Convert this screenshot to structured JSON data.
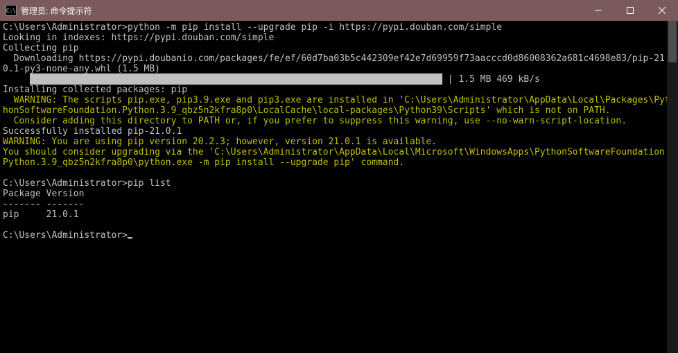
{
  "window": {
    "icon_text": "C:\\",
    "title": "管理员: 命令提示符"
  },
  "lines": [
    {
      "cls": "l-normal",
      "text": "C:\\Users\\Administrator>python -m pip install --upgrade pip -i https://pypi.douban.com/simple"
    },
    {
      "cls": "l-normal",
      "text": "Looking in indexes: https://pypi.douban.com/simple"
    },
    {
      "cls": "l-normal",
      "text": "Collecting pip"
    },
    {
      "cls": "l-normal",
      "text": "  Downloading https://pypi.doubanio.com/packages/fe/ef/60d7ba03b5c442309ef42e7d69959f73aacccd0d86008362a681c4698e83/pip-21.0.1-py3-none-any.whl (1.5 MB)"
    },
    {
      "cls": "l-normal",
      "progress": true,
      "progress_suffix": " | 1.5 MB 469 kB/s"
    },
    {
      "cls": "l-normal",
      "text": "Installing collected packages: pip"
    },
    {
      "cls": "l-warn",
      "text": "  WARNING: The scripts pip.exe, pip3.9.exe and pip3.exe are installed in 'C:\\Users\\Administrator\\AppData\\Local\\Packages\\PythonSoftwareFoundation.Python.3.9_qbz5n2kfra8p0\\LocalCache\\local-packages\\Python39\\Scripts' which is not on PATH."
    },
    {
      "cls": "l-warn",
      "text": "  Consider adding this directory to PATH or, if you prefer to suppress this warning, use --no-warn-script-location."
    },
    {
      "cls": "l-normal",
      "text": "Successfully installed pip-21.0.1"
    },
    {
      "cls": "l-warn",
      "text": "WARNING: You are using pip version 20.2.3; however, version 21.0.1 is available."
    },
    {
      "cls": "l-warn",
      "text": "You should consider upgrading via the 'C:\\Users\\Administrator\\AppData\\Local\\Microsoft\\WindowsApps\\PythonSoftwareFoundation.Python.3.9_qbz5n2kfra8p0\\python.exe -m pip install --upgrade pip' command."
    },
    {
      "cls": "l-normal",
      "text": ""
    },
    {
      "cls": "l-normal",
      "text": "C:\\Users\\Administrator>pip list"
    },
    {
      "cls": "l-normal",
      "text": "Package Version"
    },
    {
      "cls": "l-normal",
      "text": "------- -------"
    },
    {
      "cls": "l-normal",
      "text": "pip     21.0.1"
    },
    {
      "cls": "l-normal",
      "text": ""
    },
    {
      "cls": "l-normal",
      "prompt": true,
      "text": "C:\\Users\\Administrator>"
    }
  ],
  "progress_bar_fill": "████████████████████████████████████████████████████████████████████████████"
}
